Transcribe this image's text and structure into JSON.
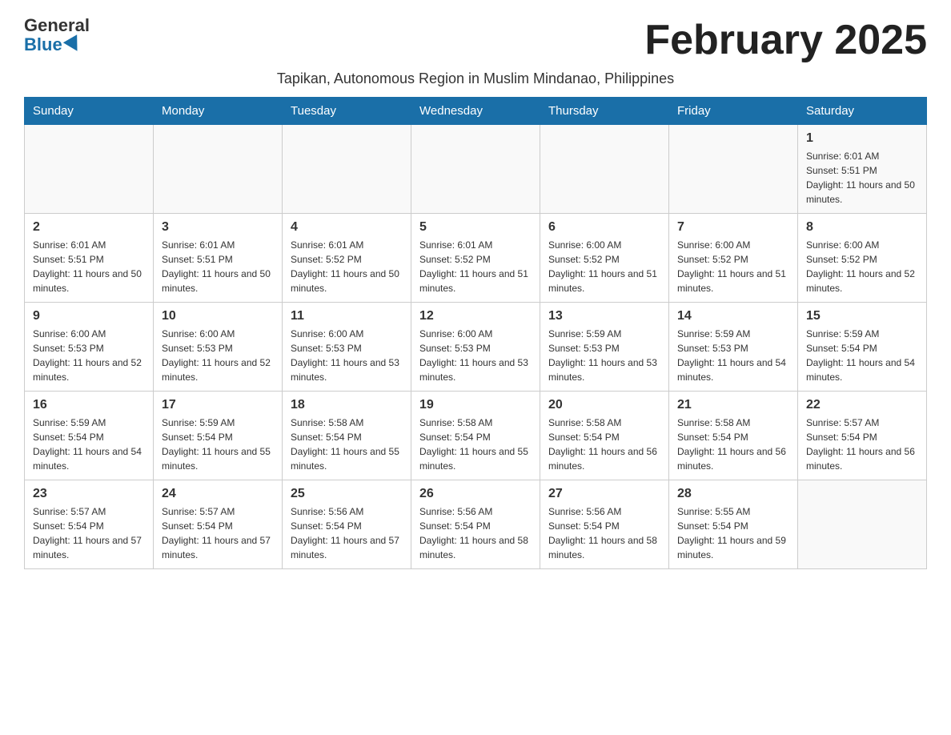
{
  "logo": {
    "general": "General",
    "blue": "Blue"
  },
  "title": "February 2025",
  "subtitle": "Tapikan, Autonomous Region in Muslim Mindanao, Philippines",
  "days_of_week": [
    "Sunday",
    "Monday",
    "Tuesday",
    "Wednesday",
    "Thursday",
    "Friday",
    "Saturday"
  ],
  "weeks": [
    [
      {
        "day": "",
        "info": ""
      },
      {
        "day": "",
        "info": ""
      },
      {
        "day": "",
        "info": ""
      },
      {
        "day": "",
        "info": ""
      },
      {
        "day": "",
        "info": ""
      },
      {
        "day": "",
        "info": ""
      },
      {
        "day": "1",
        "info": "Sunrise: 6:01 AM\nSunset: 5:51 PM\nDaylight: 11 hours and 50 minutes."
      }
    ],
    [
      {
        "day": "2",
        "info": "Sunrise: 6:01 AM\nSunset: 5:51 PM\nDaylight: 11 hours and 50 minutes."
      },
      {
        "day": "3",
        "info": "Sunrise: 6:01 AM\nSunset: 5:51 PM\nDaylight: 11 hours and 50 minutes."
      },
      {
        "day": "4",
        "info": "Sunrise: 6:01 AM\nSunset: 5:52 PM\nDaylight: 11 hours and 50 minutes."
      },
      {
        "day": "5",
        "info": "Sunrise: 6:01 AM\nSunset: 5:52 PM\nDaylight: 11 hours and 51 minutes."
      },
      {
        "day": "6",
        "info": "Sunrise: 6:00 AM\nSunset: 5:52 PM\nDaylight: 11 hours and 51 minutes."
      },
      {
        "day": "7",
        "info": "Sunrise: 6:00 AM\nSunset: 5:52 PM\nDaylight: 11 hours and 51 minutes."
      },
      {
        "day": "8",
        "info": "Sunrise: 6:00 AM\nSunset: 5:52 PM\nDaylight: 11 hours and 52 minutes."
      }
    ],
    [
      {
        "day": "9",
        "info": "Sunrise: 6:00 AM\nSunset: 5:53 PM\nDaylight: 11 hours and 52 minutes."
      },
      {
        "day": "10",
        "info": "Sunrise: 6:00 AM\nSunset: 5:53 PM\nDaylight: 11 hours and 52 minutes."
      },
      {
        "day": "11",
        "info": "Sunrise: 6:00 AM\nSunset: 5:53 PM\nDaylight: 11 hours and 53 minutes."
      },
      {
        "day": "12",
        "info": "Sunrise: 6:00 AM\nSunset: 5:53 PM\nDaylight: 11 hours and 53 minutes."
      },
      {
        "day": "13",
        "info": "Sunrise: 5:59 AM\nSunset: 5:53 PM\nDaylight: 11 hours and 53 minutes."
      },
      {
        "day": "14",
        "info": "Sunrise: 5:59 AM\nSunset: 5:53 PM\nDaylight: 11 hours and 54 minutes."
      },
      {
        "day": "15",
        "info": "Sunrise: 5:59 AM\nSunset: 5:54 PM\nDaylight: 11 hours and 54 minutes."
      }
    ],
    [
      {
        "day": "16",
        "info": "Sunrise: 5:59 AM\nSunset: 5:54 PM\nDaylight: 11 hours and 54 minutes."
      },
      {
        "day": "17",
        "info": "Sunrise: 5:59 AM\nSunset: 5:54 PM\nDaylight: 11 hours and 55 minutes."
      },
      {
        "day": "18",
        "info": "Sunrise: 5:58 AM\nSunset: 5:54 PM\nDaylight: 11 hours and 55 minutes."
      },
      {
        "day": "19",
        "info": "Sunrise: 5:58 AM\nSunset: 5:54 PM\nDaylight: 11 hours and 55 minutes."
      },
      {
        "day": "20",
        "info": "Sunrise: 5:58 AM\nSunset: 5:54 PM\nDaylight: 11 hours and 56 minutes."
      },
      {
        "day": "21",
        "info": "Sunrise: 5:58 AM\nSunset: 5:54 PM\nDaylight: 11 hours and 56 minutes."
      },
      {
        "day": "22",
        "info": "Sunrise: 5:57 AM\nSunset: 5:54 PM\nDaylight: 11 hours and 56 minutes."
      }
    ],
    [
      {
        "day": "23",
        "info": "Sunrise: 5:57 AM\nSunset: 5:54 PM\nDaylight: 11 hours and 57 minutes."
      },
      {
        "day": "24",
        "info": "Sunrise: 5:57 AM\nSunset: 5:54 PM\nDaylight: 11 hours and 57 minutes."
      },
      {
        "day": "25",
        "info": "Sunrise: 5:56 AM\nSunset: 5:54 PM\nDaylight: 11 hours and 57 minutes."
      },
      {
        "day": "26",
        "info": "Sunrise: 5:56 AM\nSunset: 5:54 PM\nDaylight: 11 hours and 58 minutes."
      },
      {
        "day": "27",
        "info": "Sunrise: 5:56 AM\nSunset: 5:54 PM\nDaylight: 11 hours and 58 minutes."
      },
      {
        "day": "28",
        "info": "Sunrise: 5:55 AM\nSunset: 5:54 PM\nDaylight: 11 hours and 59 minutes."
      },
      {
        "day": "",
        "info": ""
      }
    ]
  ]
}
